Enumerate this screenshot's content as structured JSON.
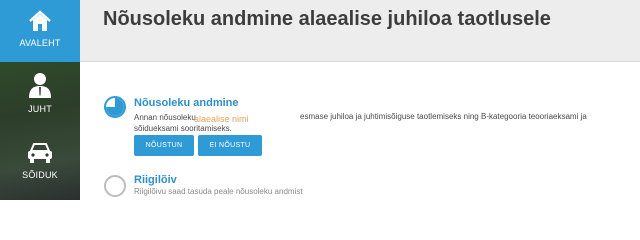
{
  "sidebar": {
    "items": [
      {
        "label": "AVALEHT",
        "icon": "home-icon",
        "active": true
      },
      {
        "label": "JUHT",
        "icon": "person-icon",
        "active": false
      },
      {
        "label": "SÕIDUK",
        "icon": "car-icon",
        "active": false
      }
    ]
  },
  "header": {
    "title": "Nõusoleku andmine alaealise juhiloa taotlusele"
  },
  "steps": [
    {
      "title": "Nõusoleku andmine",
      "text_prefix": "Annan nõusoleku",
      "placeholder": "alaealise nimi",
      "text_suffix": "esmase juhiloa ja juhtimisõiguse taotlemiseks ning B-kategooria teooriaeksami ja",
      "text_line2": "sõidueksami sooritamiseks.",
      "buttons": {
        "agree": "NÕUSTUN",
        "disagree": "EI NÕUSTU"
      }
    },
    {
      "title": "Riigilõiv",
      "text": "Riigilõivu saad tasuda peale nõusoleku andmist"
    }
  ],
  "colors": {
    "accent": "#2f9bd6",
    "placeholder": "#e1a55e",
    "header_bg": "#ecedec"
  }
}
